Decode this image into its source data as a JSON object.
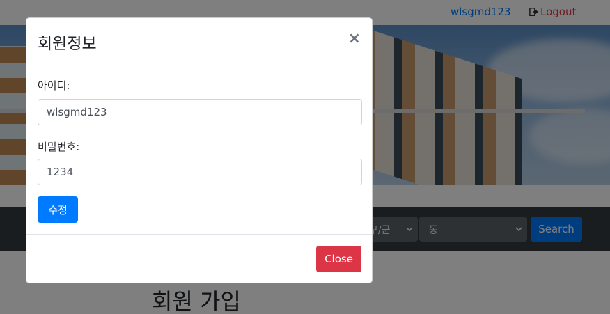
{
  "header": {
    "username": "wlsgmd123",
    "logout_label": "Logout"
  },
  "search_bar": {
    "district_select": "구/군",
    "dong_select": "동",
    "search_label": "Search"
  },
  "page": {
    "signup_title": "회원 가입"
  },
  "modal": {
    "title": "회원정보",
    "close_icon": "×",
    "id_label": "아이디:",
    "id_value": "wlsgmd123",
    "password_label": "비밀번호:",
    "password_value": "1234",
    "edit_label": "수정",
    "close_label": "Close"
  },
  "colors": {
    "primary": "#007bff",
    "danger": "#dc3545",
    "dark_nav": "#343a40"
  },
  "icons": {
    "logout": "sign-out-icon",
    "close": "close-icon",
    "select_chevron": "chevron-down-icon"
  }
}
